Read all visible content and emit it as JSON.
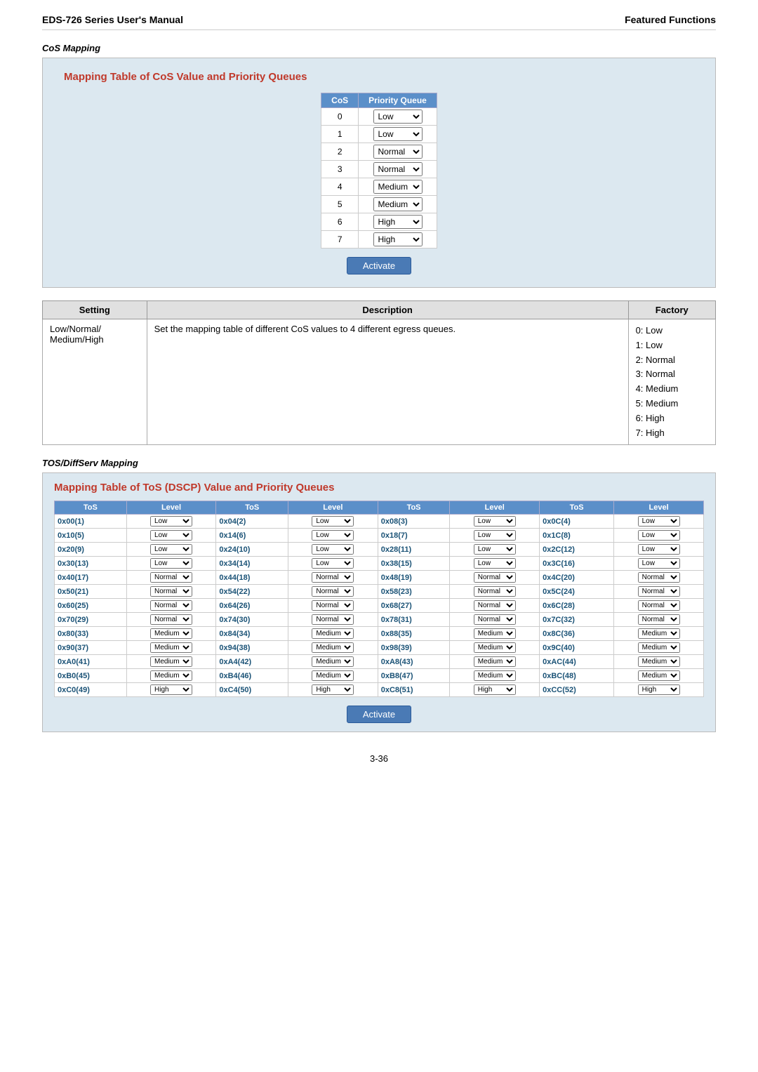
{
  "header": {
    "left": "EDS-726 Series User's Manual",
    "right": "Featured Functions"
  },
  "cos_section": {
    "title": "CoS Mapping",
    "box_title": "Mapping Table of CoS Value and Priority Queues",
    "table_headers": [
      "CoS",
      "Priority Queue"
    ],
    "cos_rows": [
      {
        "cos": "0",
        "queue": "Low"
      },
      {
        "cos": "1",
        "queue": "Low"
      },
      {
        "cos": "2",
        "queue": "Normal"
      },
      {
        "cos": "3",
        "queue": "Normal"
      },
      {
        "cos": "4",
        "queue": "Medium"
      },
      {
        "cos": "5",
        "queue": "Medium"
      },
      {
        "cos": "6",
        "queue": "High"
      },
      {
        "cos": "7",
        "queue": "High"
      }
    ],
    "activate_label": "Activate"
  },
  "setting_table": {
    "headers": [
      "Setting",
      "Description",
      "Factory"
    ],
    "rows": [
      {
        "setting": "Low/Normal/\nMedium/High",
        "description": "Set the mapping table of different CoS values to 4 different egress queues.",
        "factory": "0: Low\n1: Low\n2: Normal\n3: Normal\n4: Medium\n5: Medium\n6: High\n7: High"
      }
    ]
  },
  "tos_section": {
    "title": "TOS/DiffServ Mapping",
    "box_title": "Mapping Table of ToS (DSCP) Value and Priority Queues",
    "table_headers": [
      "ToS",
      "Level",
      "ToS",
      "Level",
      "ToS",
      "Level",
      "ToS",
      "Level"
    ],
    "activate_label": "Activate",
    "tos_rows": [
      [
        "0x00(1)",
        "Low",
        "0x04(2)",
        "Low",
        "0x08(3)",
        "Low",
        "0x0C(4)",
        "Low"
      ],
      [
        "0x10(5)",
        "Low",
        "0x14(6)",
        "Low",
        "0x18(7)",
        "Low",
        "0x1C(8)",
        "Low"
      ],
      [
        "0x20(9)",
        "Low",
        "0x24(10)",
        "Low",
        "0x28(11)",
        "Low",
        "0x2C(12)",
        "Low"
      ],
      [
        "0x30(13)",
        "Low",
        "0x34(14)",
        "Low",
        "0x38(15)",
        "Low",
        "0x3C(16)",
        "Low"
      ],
      [
        "0x40(17)",
        "Normal",
        "0x44(18)",
        "Normal",
        "0x48(19)",
        "Normal",
        "0x4C(20)",
        "Normal"
      ],
      [
        "0x50(21)",
        "Normal",
        "0x54(22)",
        "Normal",
        "0x58(23)",
        "Normal",
        "0x5C(24)",
        "Normal"
      ],
      [
        "0x60(25)",
        "Normal",
        "0x64(26)",
        "Normal",
        "0x68(27)",
        "Normal",
        "0x6C(28)",
        "Normal"
      ],
      [
        "0x70(29)",
        "Normal",
        "0x74(30)",
        "Normal",
        "0x78(31)",
        "Normal",
        "0x7C(32)",
        "Normal"
      ],
      [
        "0x80(33)",
        "Medium",
        "0x84(34)",
        "Medium",
        "0x88(35)",
        "Medium",
        "0x8C(36)",
        "Medium"
      ],
      [
        "0x90(37)",
        "Medium",
        "0x94(38)",
        "Medium",
        "0x98(39)",
        "Medium",
        "0x9C(40)",
        "Medium"
      ],
      [
        "0xA0(41)",
        "Medium",
        "0xA4(42)",
        "Medium",
        "0xA8(43)",
        "Medium",
        "0xAC(44)",
        "Medium"
      ],
      [
        "0xB0(45)",
        "Medium",
        "0xB4(46)",
        "Medium",
        "0xB8(47)",
        "Medium",
        "0xBC(48)",
        "Medium"
      ],
      [
        "0xC0(49)",
        "High",
        "0xC4(50)",
        "High",
        "0xC8(51)",
        "High",
        "0xCC(52)",
        "High"
      ]
    ]
  },
  "page_number": "3-36",
  "queue_options": [
    "Low",
    "Normal",
    "Medium",
    "High"
  ]
}
